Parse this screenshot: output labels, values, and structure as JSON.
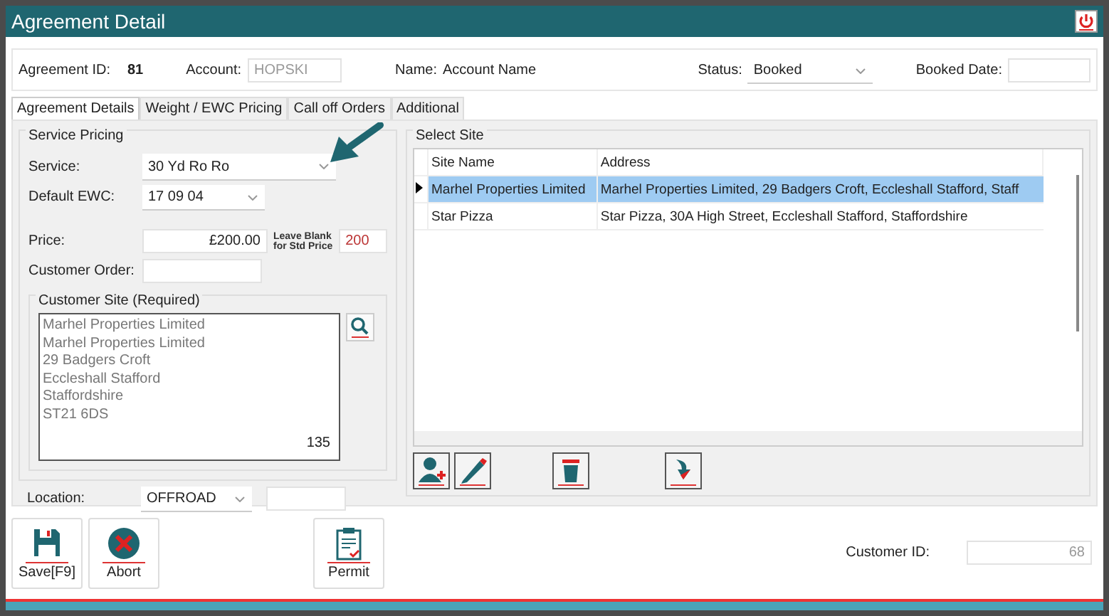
{
  "window": {
    "title": "Agreement Detail"
  },
  "header": {
    "agreement_id_label": "Agreement ID:",
    "agreement_id": "81",
    "account_label": "Account:",
    "account": "HOPSKI",
    "name_label": "Name:",
    "name": "Account Name",
    "status_label": "Status:",
    "status": "Booked",
    "booked_date_label": "Booked Date:"
  },
  "tabs": [
    {
      "label": "Agreement Details",
      "selected": true
    },
    {
      "label": "Weight / EWC Pricing",
      "selected": false
    },
    {
      "label": "Call off Orders",
      "selected": false
    },
    {
      "label": "Additional",
      "selected": false
    }
  ],
  "service_pricing": {
    "title": "Service Pricing",
    "service_label": "Service:",
    "service": "30 Yd Ro Ro",
    "ewc_label": "Default EWC:",
    "ewc": "17 09 04",
    "price_label": "Price:",
    "price": "£200.00",
    "hint_lines": [
      "Leave Blank",
      "for Std Price"
    ],
    "std_price": "200",
    "customer_order_label": "Customer Order:"
  },
  "customer_site": {
    "title": "Customer Site (Required)",
    "lines": [
      "Marhel Properties Limited",
      "Marhel Properties Limited",
      "29 Badgers Croft",
      "Eccleshall Stafford",
      "Staffordshire",
      "ST21 6DS"
    ],
    "number": "135"
  },
  "location": {
    "label": "Location:",
    "value": "OFFROAD"
  },
  "select_site": {
    "title": "Select Site",
    "columns": [
      "Site Name",
      "Address"
    ],
    "rows": [
      {
        "site_name": "Marhel Properties Limited",
        "address": "Marhel Properties Limited, 29 Badgers Croft, Eccleshall Stafford, Staff",
        "selected": true
      },
      {
        "site_name": "Star Pizza",
        "address": "Star Pizza, 30A High Street, Eccleshall Stafford, Staffordshire",
        "selected": false
      }
    ]
  },
  "footer": {
    "buttons": [
      {
        "label": "Save[F9]",
        "kind": "save"
      },
      {
        "label": "Abort",
        "kind": "abort"
      },
      {
        "label": "Permit",
        "kind": "permit"
      }
    ],
    "customer_id_label": "Customer ID:",
    "customer_id": "68"
  }
}
